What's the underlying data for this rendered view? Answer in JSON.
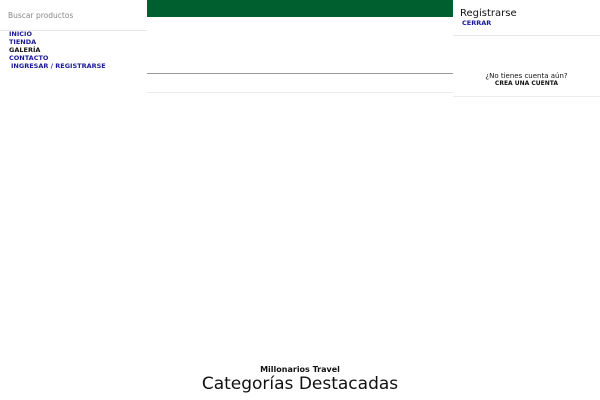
{
  "search": {
    "placeholder": "Buscar productos"
  },
  "nav": {
    "items": [
      {
        "label": "INICIO"
      },
      {
        "label": "TIENDA"
      },
      {
        "label": "GALERÍA"
      },
      {
        "label": "CONTACTO"
      }
    ],
    "login_label": "INGRESAR / REGISTRARSE"
  },
  "account": {
    "title": "Registrarse",
    "close_label": "CERRAR",
    "no_account_text": "¿No tienes cuenta aún?",
    "create_account_label": "CREA UNA CUENTA"
  },
  "site": {
    "name": "Millonarios Travel",
    "section_title": "Categorías Destacadas"
  },
  "colors": {
    "brand_green": "#005f2f",
    "link_blue": "#1a1a99"
  }
}
